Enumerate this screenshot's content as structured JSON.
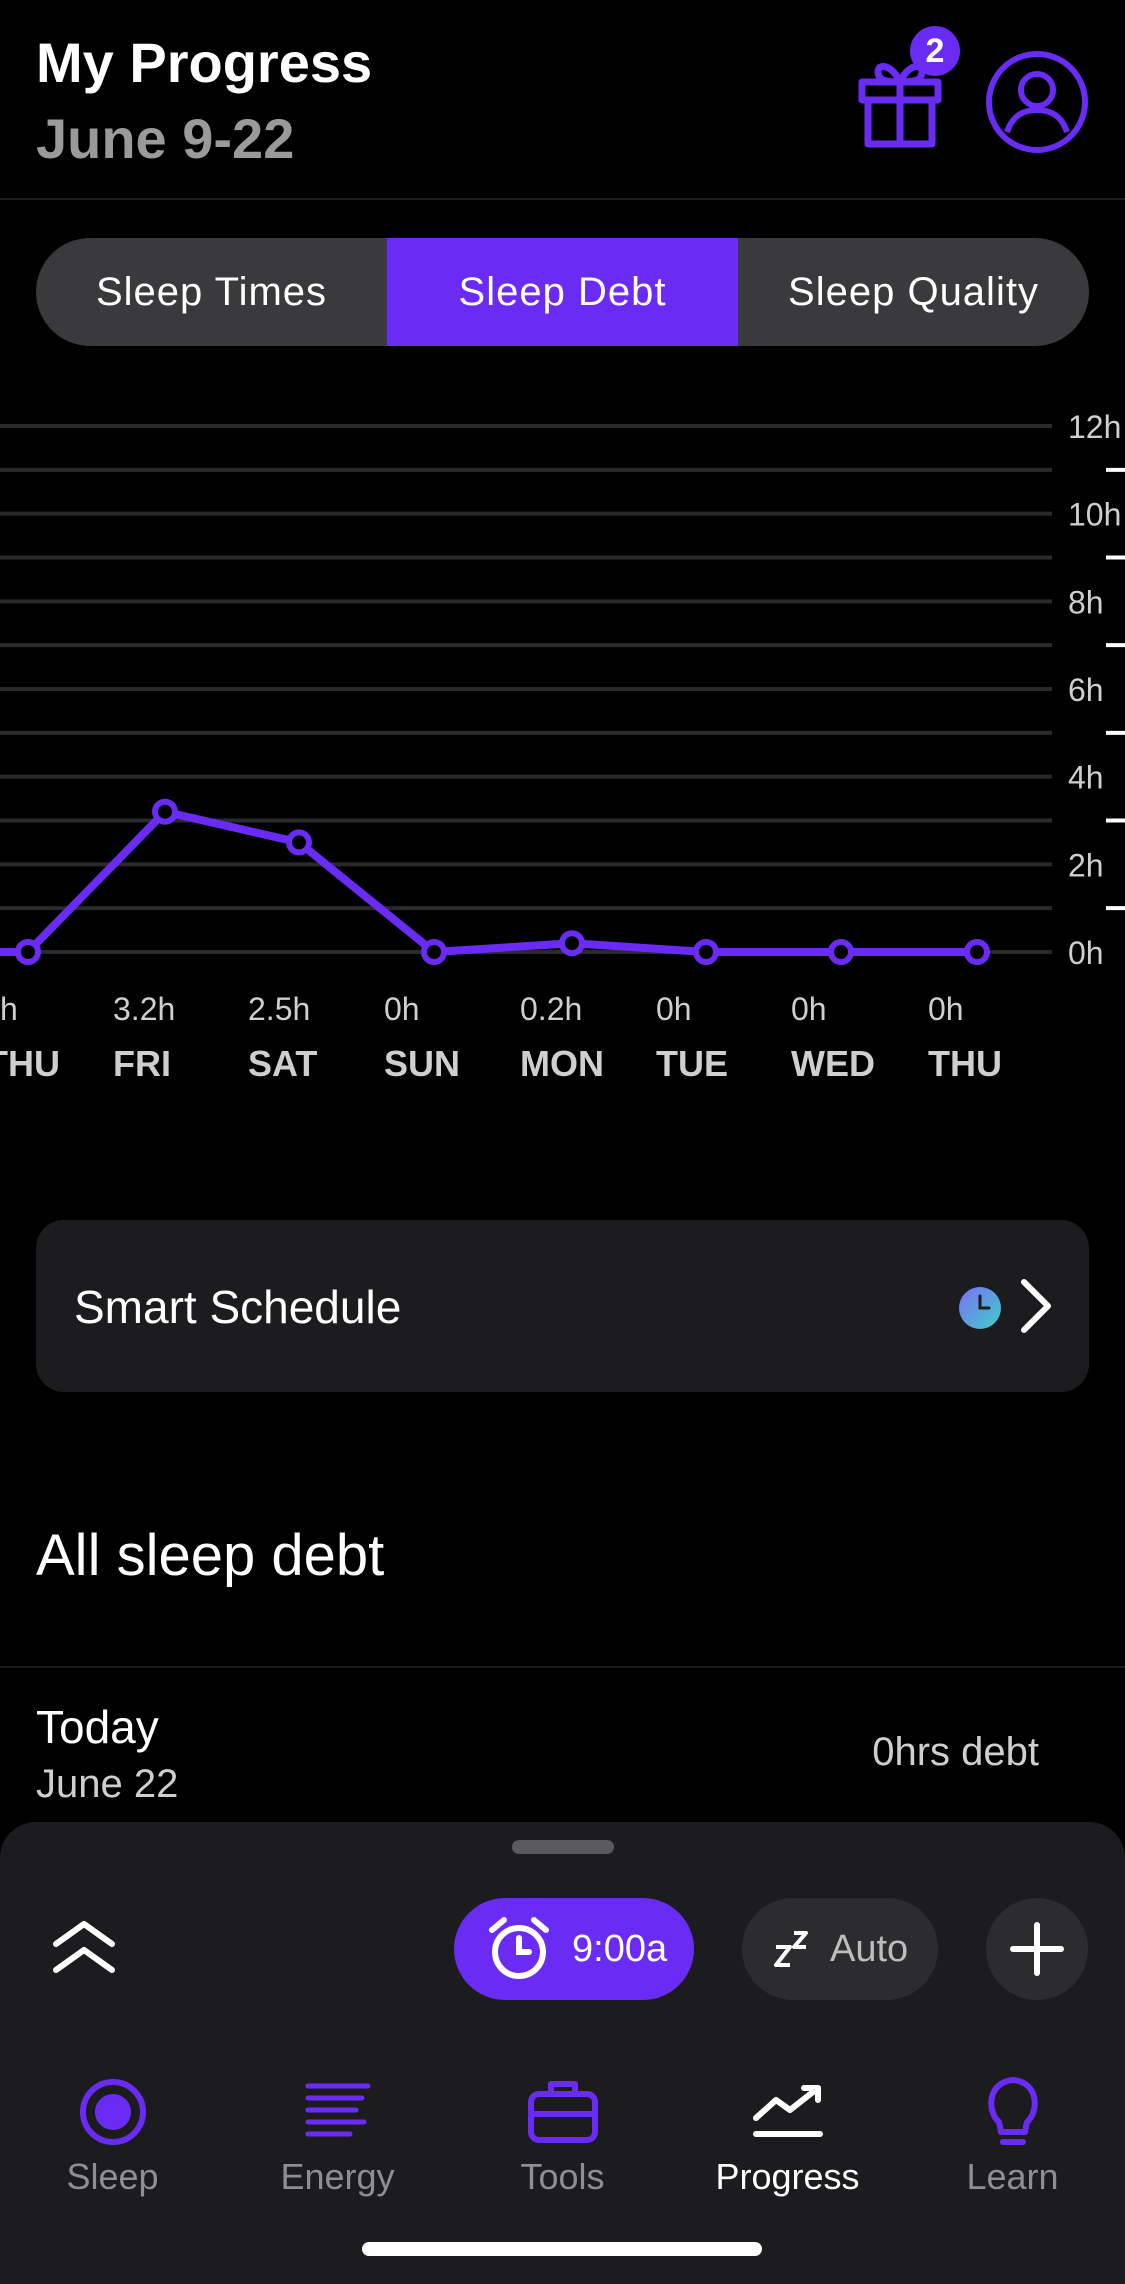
{
  "header": {
    "title": "My Progress",
    "subtitle": "June 9-22",
    "gift_badge": "2"
  },
  "tabs": [
    {
      "label": "Sleep Times",
      "active": false
    },
    {
      "label": "Sleep Debt",
      "active": true
    },
    {
      "label": "Sleep Quality",
      "active": false
    }
  ],
  "chart_data": {
    "type": "line",
    "y_ticks": [
      "12h",
      "10h",
      "8h",
      "6h",
      "4h",
      "2h",
      "0h"
    ],
    "ylim": [
      0,
      12
    ],
    "points": [
      {
        "day": "THU",
        "label": "h",
        "value": 0
      },
      {
        "day": "FRI",
        "label": "3.2h",
        "value": 3.2
      },
      {
        "day": "SAT",
        "label": "2.5h",
        "value": 2.5
      },
      {
        "day": "SUN",
        "label": "0h",
        "value": 0
      },
      {
        "day": "MON",
        "label": "0.2h",
        "value": 0.2
      },
      {
        "day": "TUE",
        "label": "0h",
        "value": 0
      },
      {
        "day": "WED",
        "label": "0h",
        "value": 0
      },
      {
        "day": "THU",
        "label": "0h",
        "value": 0
      }
    ],
    "line_color": "#6a2cf5",
    "grid": true
  },
  "smart_schedule": {
    "label": "Smart Schedule"
  },
  "section": {
    "title": "All sleep debt"
  },
  "debt_row": {
    "title": "Today",
    "date": "June 22",
    "value": "0hrs debt"
  },
  "sheet": {
    "alarm_label": "9:00a",
    "auto_label": "Auto"
  },
  "nav": [
    {
      "label": "Sleep",
      "icon": "sleep-icon",
      "active": false
    },
    {
      "label": "Energy",
      "icon": "energy-icon",
      "active": false
    },
    {
      "label": "Tools",
      "icon": "toolbox-icon",
      "active": false
    },
    {
      "label": "Progress",
      "icon": "trend-icon",
      "active": true
    },
    {
      "label": "Learn",
      "icon": "lightbulb-icon",
      "active": false
    }
  ],
  "colors": {
    "accent": "#6a2cf5",
    "background": "#000000",
    "card": "#1c1c1e"
  }
}
